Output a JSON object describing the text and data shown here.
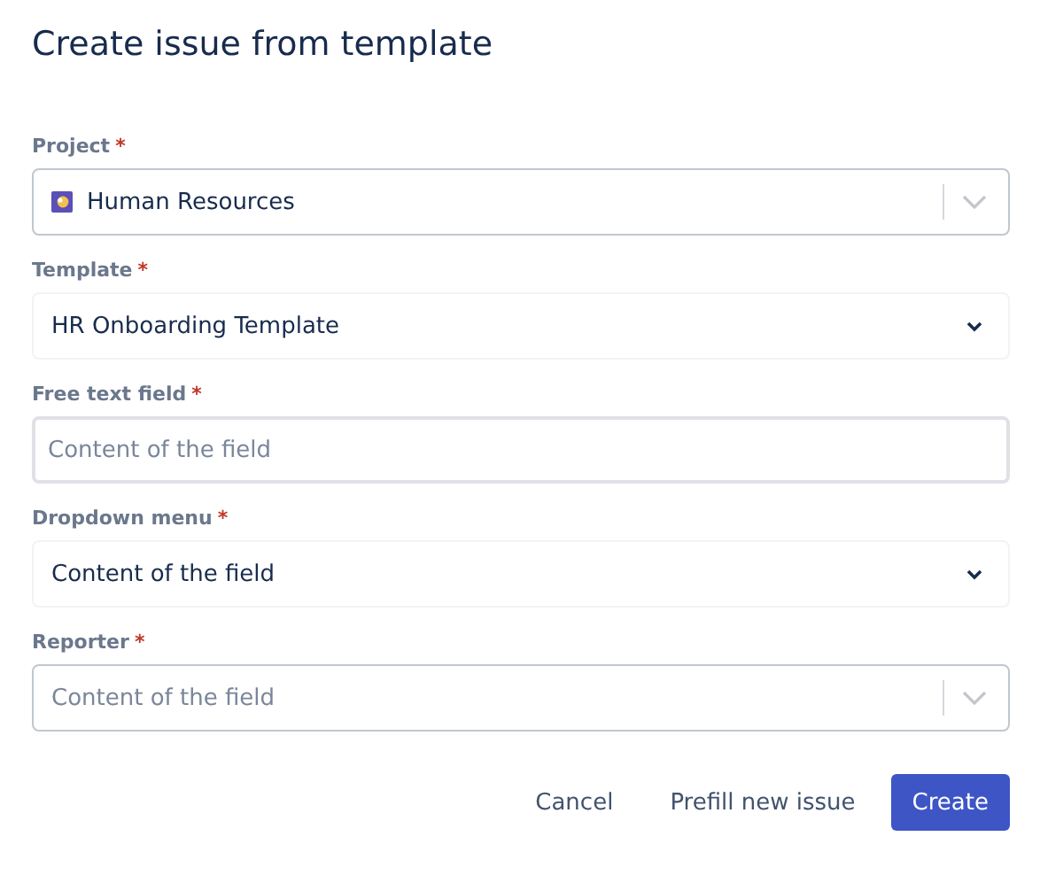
{
  "title": "Create issue from template",
  "fields": [
    {
      "label": "Project",
      "required_mark": "*",
      "kind": "select",
      "value": "Human Resources",
      "has_icon": true
    },
    {
      "label": "Template",
      "required_mark": "*",
      "kind": "native-select",
      "value": "HR Onboarding Template"
    },
    {
      "label": "Free text field",
      "required_mark": "*",
      "kind": "text",
      "placeholder": "Content of the field"
    },
    {
      "label": "Dropdown menu",
      "required_mark": "*",
      "kind": "native-select",
      "value": "Content of the field"
    },
    {
      "label": "Reporter",
      "required_mark": "*",
      "kind": "select",
      "placeholder": "Content of the field"
    }
  ],
  "buttons": [
    {
      "label": "Cancel",
      "kind": "subtle"
    },
    {
      "label": "Prefill new issue",
      "kind": "subtle"
    },
    {
      "label": "Create",
      "kind": "primary"
    }
  ]
}
